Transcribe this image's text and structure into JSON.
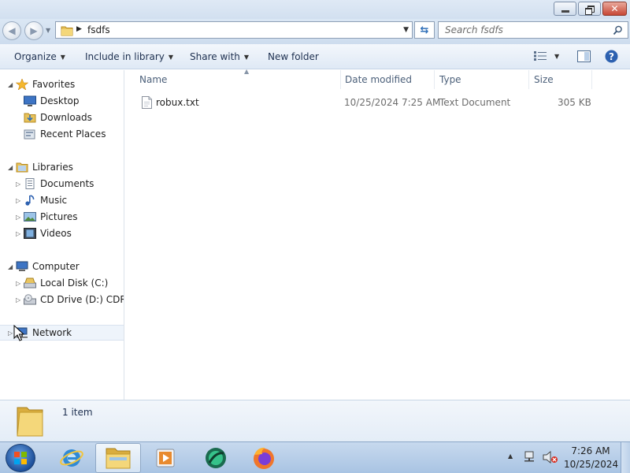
{
  "window": {
    "controls": {
      "minimize_icon": "minimize-icon",
      "maximize_icon": "restore-icon",
      "close_icon": "close-icon"
    }
  },
  "address_bar": {
    "path": "fsdfs",
    "search_placeholder": "Search fsdfs"
  },
  "toolbar": {
    "organize": "Organize",
    "include_in_library": "Include in library",
    "share_with": "Share with",
    "new_folder": "New folder"
  },
  "nav_pane": {
    "favorites": {
      "label": "Favorites",
      "items": [
        {
          "label": "Desktop",
          "icon": "desktop-icon"
        },
        {
          "label": "Downloads",
          "icon": "downloads-icon"
        },
        {
          "label": "Recent Places",
          "icon": "recent-places-icon"
        }
      ]
    },
    "libraries": {
      "label": "Libraries",
      "items": [
        {
          "label": "Documents",
          "icon": "documents-icon"
        },
        {
          "label": "Music",
          "icon": "music-icon"
        },
        {
          "label": "Pictures",
          "icon": "pictures-icon"
        },
        {
          "label": "Videos",
          "icon": "videos-icon"
        }
      ]
    },
    "computer": {
      "label": "Computer",
      "items": [
        {
          "label": "Local Disk (C:)",
          "icon": "hard-disk-icon"
        },
        {
          "label": "CD Drive (D:) CDROM",
          "icon": "cd-drive-icon"
        }
      ]
    },
    "network": {
      "label": "Network",
      "icon": "network-icon"
    }
  },
  "file_list": {
    "columns": [
      "Name",
      "Date modified",
      "Type",
      "Size"
    ],
    "rows": [
      {
        "name": "robux.txt",
        "date_modified": "10/25/2024 7:25 AM",
        "type": "Text Document",
        "size": "305 KB"
      }
    ]
  },
  "details_pane": {
    "item_count": "1 item"
  },
  "taskbar": {
    "apps": [
      "internet-explorer-icon",
      "windows-explorer-icon",
      "windows-media-player-icon",
      "app-icon",
      "firefox-icon"
    ],
    "clock_time": "7:26 AM",
    "clock_date": "10/25/2024"
  },
  "colors": {
    "accent": "#2f6fb8",
    "toolbar_text": "#1e3050",
    "header_text": "#4c607a"
  }
}
